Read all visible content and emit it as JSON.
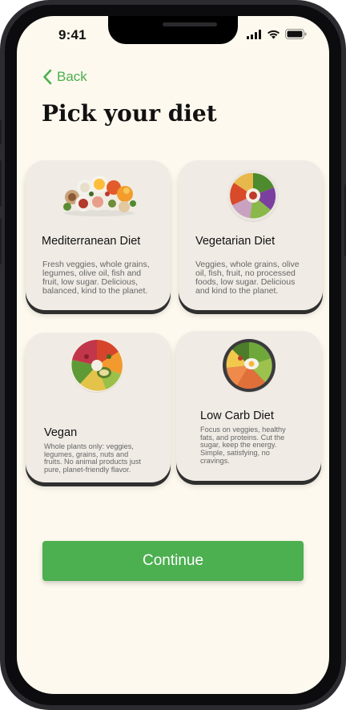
{
  "status_bar": {
    "time": "9:41",
    "icons": [
      "cellular-signal-icon",
      "wifi-icon",
      "battery-icon"
    ]
  },
  "nav": {
    "back_label": "Back"
  },
  "page": {
    "title": "Pick your diet"
  },
  "diets": [
    {
      "name": "Mediterranean Diet",
      "description": "Fresh veggies, whole grains, legumes, olive oil, fish and fruit, low sugar. Delicious, balanced, kind to the planet.",
      "icon": "mediterranean-food-icon"
    },
    {
      "name": "Vegetarian Diet",
      "description": "Veggies, whole grains, olive oil, fish, fruit, no processed foods, low sugar. Delicious and kind to the planet.",
      "icon": "vegetarian-bowl-icon"
    },
    {
      "name": "Vegan",
      "description": "Whole plants only: veggies, legumes, grains, nuts and fruits. No animal products just pure, planet-friendly flavor.",
      "icon": "vegan-platter-icon"
    },
    {
      "name": "Low Carb Diet",
      "description": "Focus on veggies, healthy fats, and proteins. Cut the sugar, keep the energy. Simple, satisfying, no cravings.",
      "icon": "low-carb-bowl-icon"
    }
  ],
  "actions": {
    "continue_label": "Continue"
  },
  "colors": {
    "accent": "#4caf50",
    "background": "#fdf9ee",
    "card": "#f0ebe5"
  }
}
